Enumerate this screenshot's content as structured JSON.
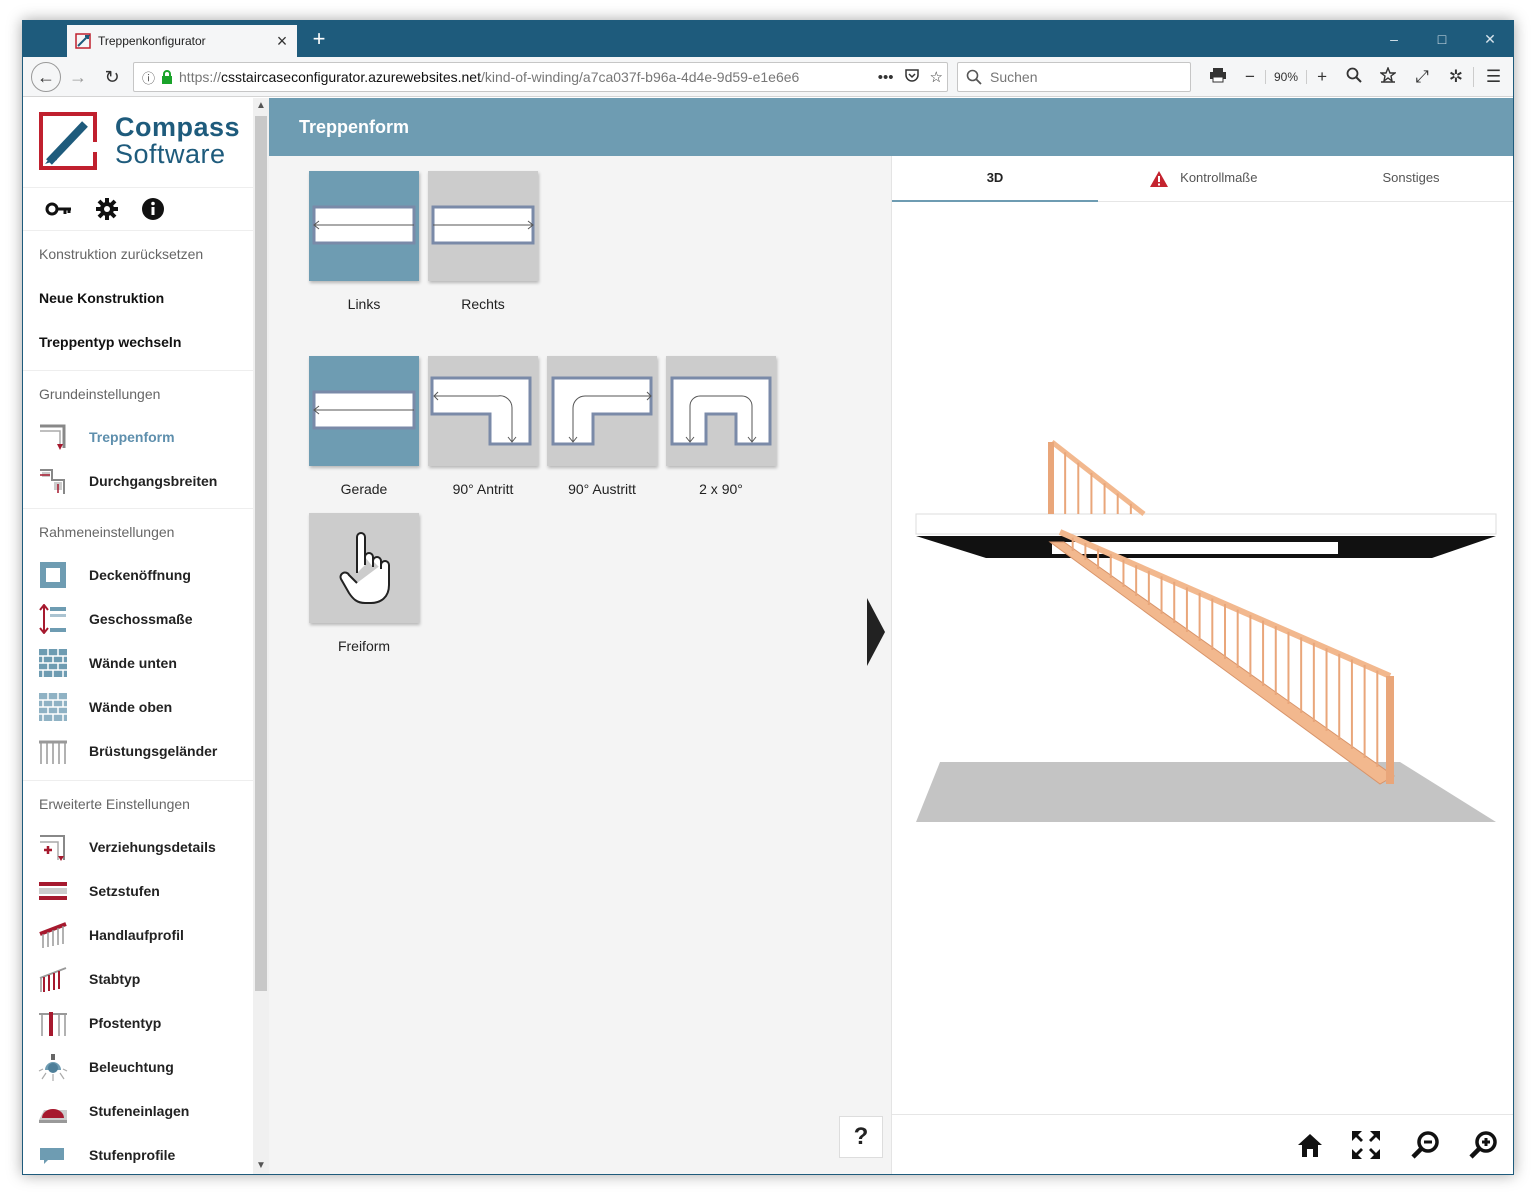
{
  "browser": {
    "tab_title": "Treppenkonfigurator",
    "tab_close": "×",
    "new_tab": "+",
    "url_scheme": "https://",
    "url_host": "csstaircaseconfigurator.azurewebsites.net",
    "url_path": "/kind-of-winding/a7ca037f-b96a-4d4e-9d59-e1e6e6",
    "search_placeholder": "Suchen",
    "zoom": "90%",
    "window_controls": {
      "minimize": "–",
      "maximize": "□",
      "close": "✕"
    }
  },
  "logo": {
    "line1": "Compass",
    "line2": "Software"
  },
  "sidebar": {
    "actions": [
      {
        "label": "Konstruktion zurücksetzen",
        "style": "muted"
      },
      {
        "label": "Neue Konstruktion",
        "style": "bold"
      },
      {
        "label": "Treppentyp wechseln",
        "style": "bold"
      }
    ],
    "sections": [
      {
        "title": "Grundeinstellungen",
        "items": [
          {
            "label": "Treppenform",
            "icon": "stair-shape-icon",
            "active": true
          },
          {
            "label": "Durchgangsbreiten",
            "icon": "passage-width-icon",
            "active": false
          }
        ]
      },
      {
        "title": "Rahmeneinstellungen",
        "items": [
          {
            "label": "Deckenöffnung",
            "icon": "ceiling-opening-icon",
            "active": false
          },
          {
            "label": "Geschossmaße",
            "icon": "floor-height-icon",
            "active": false
          },
          {
            "label": "Wände unten",
            "icon": "wall-bottom-icon",
            "active": false
          },
          {
            "label": "Wände oben",
            "icon": "wall-top-icon",
            "active": false
          },
          {
            "label": "Brüstungsgeländer",
            "icon": "balustrade-icon",
            "active": false
          }
        ]
      },
      {
        "title": "Erweiterte Einstellungen",
        "items": [
          {
            "label": "Verziehungsdetails",
            "icon": "winding-details-icon",
            "active": false
          },
          {
            "label": "Setzstufen",
            "icon": "riser-icon",
            "active": false
          },
          {
            "label": "Handlaufprofil",
            "icon": "handrail-icon",
            "active": false
          },
          {
            "label": "Stabtyp",
            "icon": "baluster-icon",
            "active": false
          },
          {
            "label": "Pfostentyp",
            "icon": "post-icon",
            "active": false
          },
          {
            "label": "Beleuchtung",
            "icon": "lighting-icon",
            "active": false
          },
          {
            "label": "Stufeneinlagen",
            "icon": "step-insert-icon",
            "active": false
          },
          {
            "label": "Stufenprofile",
            "icon": "step-profile-icon",
            "active": false
          }
        ]
      }
    ]
  },
  "main": {
    "title": "Treppenform",
    "direction_options": [
      {
        "label": "Links",
        "selected": true
      },
      {
        "label": "Rechts",
        "selected": false
      }
    ],
    "shape_options": [
      {
        "label": "Gerade",
        "selected": true
      },
      {
        "label": "90° Antritt",
        "selected": false
      },
      {
        "label": "90° Austritt",
        "selected": false
      },
      {
        "label": "2 x 90°",
        "selected": false
      },
      {
        "label": "Freiform",
        "selected": false
      }
    ],
    "help": "?"
  },
  "viewer": {
    "tabs": [
      {
        "label": "3D",
        "active": true,
        "warning": false
      },
      {
        "label": "Kontrollmaße",
        "active": false,
        "warning": true
      },
      {
        "label": "Sonstiges",
        "active": false,
        "warning": false
      }
    ]
  },
  "colors": {
    "accent": "#6e9cb2",
    "browser_frame": "#1e5b7c",
    "logo_red": "#c0202e",
    "wood": "#f2b88e",
    "icon_red": "#a6192e"
  }
}
